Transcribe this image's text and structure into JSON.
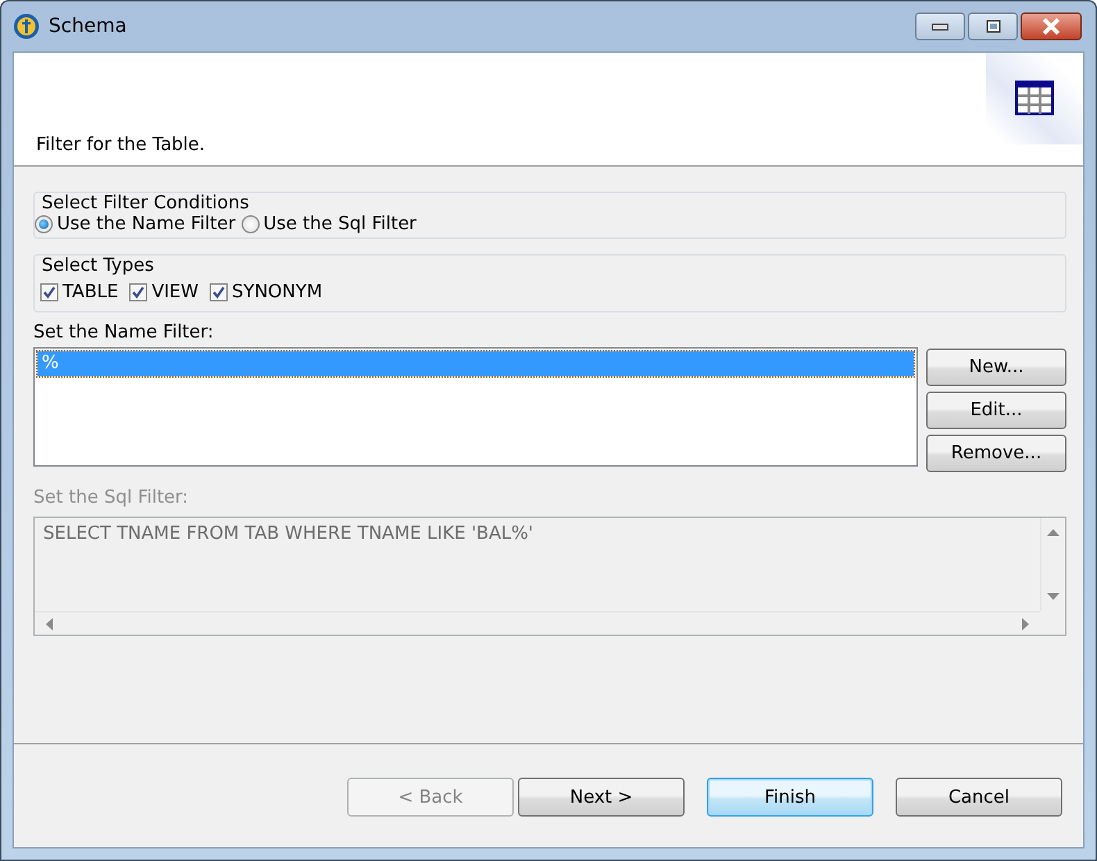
{
  "window": {
    "title": "Schema"
  },
  "header": {
    "message": "Filter for the Table."
  },
  "filter_conditions": {
    "title": "Select Filter Conditions",
    "options": [
      {
        "label": "Use the Name Filter",
        "selected": true
      },
      {
        "label": "Use the Sql Filter",
        "selected": false
      }
    ]
  },
  "types": {
    "title": "Select Types",
    "items": [
      {
        "label": "TABLE",
        "checked": true
      },
      {
        "label": "VIEW",
        "checked": true
      },
      {
        "label": "SYNONYM",
        "checked": true
      }
    ]
  },
  "name_filter": {
    "label": "Set the Name Filter:",
    "items": [
      {
        "text": "%",
        "selected": true
      }
    ],
    "buttons": [
      "New...",
      "Edit...",
      "Remove..."
    ]
  },
  "sql_filter": {
    "label": "Set the Sql Filter:",
    "value": "SELECT TNAME FROM TAB WHERE TNAME LIKE 'BAL%'",
    "disabled": true
  },
  "buttons": [
    {
      "label": "< Back",
      "disabled": true,
      "default": false
    },
    {
      "label": "Next >",
      "disabled": false,
      "default": false
    },
    {
      "label": "Finish",
      "disabled": false,
      "default": true
    },
    {
      "label": "Cancel",
      "disabled": false,
      "default": false
    }
  ]
}
